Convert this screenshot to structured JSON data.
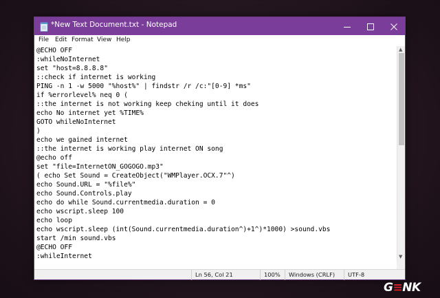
{
  "window": {
    "title": "*New Text Document.txt - Notepad",
    "accent_color": "#7a3d99",
    "icon": "notepad-icon"
  },
  "controls": {
    "minimize_icon": "minimize-icon",
    "maximize_icon": "maximize-icon",
    "close_icon": "close-icon"
  },
  "menu": [
    "File",
    "Edit",
    "Format",
    "View",
    "Help"
  ],
  "editor": {
    "lines": [
      "@ECHO OFF",
      ":whileNoInternet",
      "set \"host=8.8.8.8\"",
      "::check if internet is working",
      "PING -n 1 -w 5000 \"%host%\" | findstr /r /c:\"[0-9] *ms\"",
      "if %errorlevel% neq 0 (",
      "::the internet is not working keep cheking until it does",
      "echo No internet yet %TIME%",
      "GOTO whileNoInternet",
      ")",
      "echo we gained internet",
      "::the internet is working play internet ON song",
      "@echo off",
      "set \"file=InternetON_GOGOGO.mp3\"",
      "( echo Set Sound = CreateObject(\"WMPlayer.OCX.7\"^)",
      "echo Sound.URL = \"%file%\"",
      "echo Sound.Controls.play",
      "echo do while Sound.currentmedia.duration = 0",
      "echo wscript.sleep 100",
      "echo loop",
      "echo wscript.sleep (int(Sound.currentmedia.duration^)+1^)*1000) >sound.vbs",
      "start /min sound.vbs",
      "@ECHO OFF",
      ":whileInternet"
    ]
  },
  "statusbar": {
    "position": "Ln 56, Col 21",
    "zoom": "100%",
    "line_ending": "Windows (CRLF)",
    "encoding": "UTF-8"
  },
  "watermark": {
    "brand": "GENK",
    "brand_color": "#d62027"
  }
}
